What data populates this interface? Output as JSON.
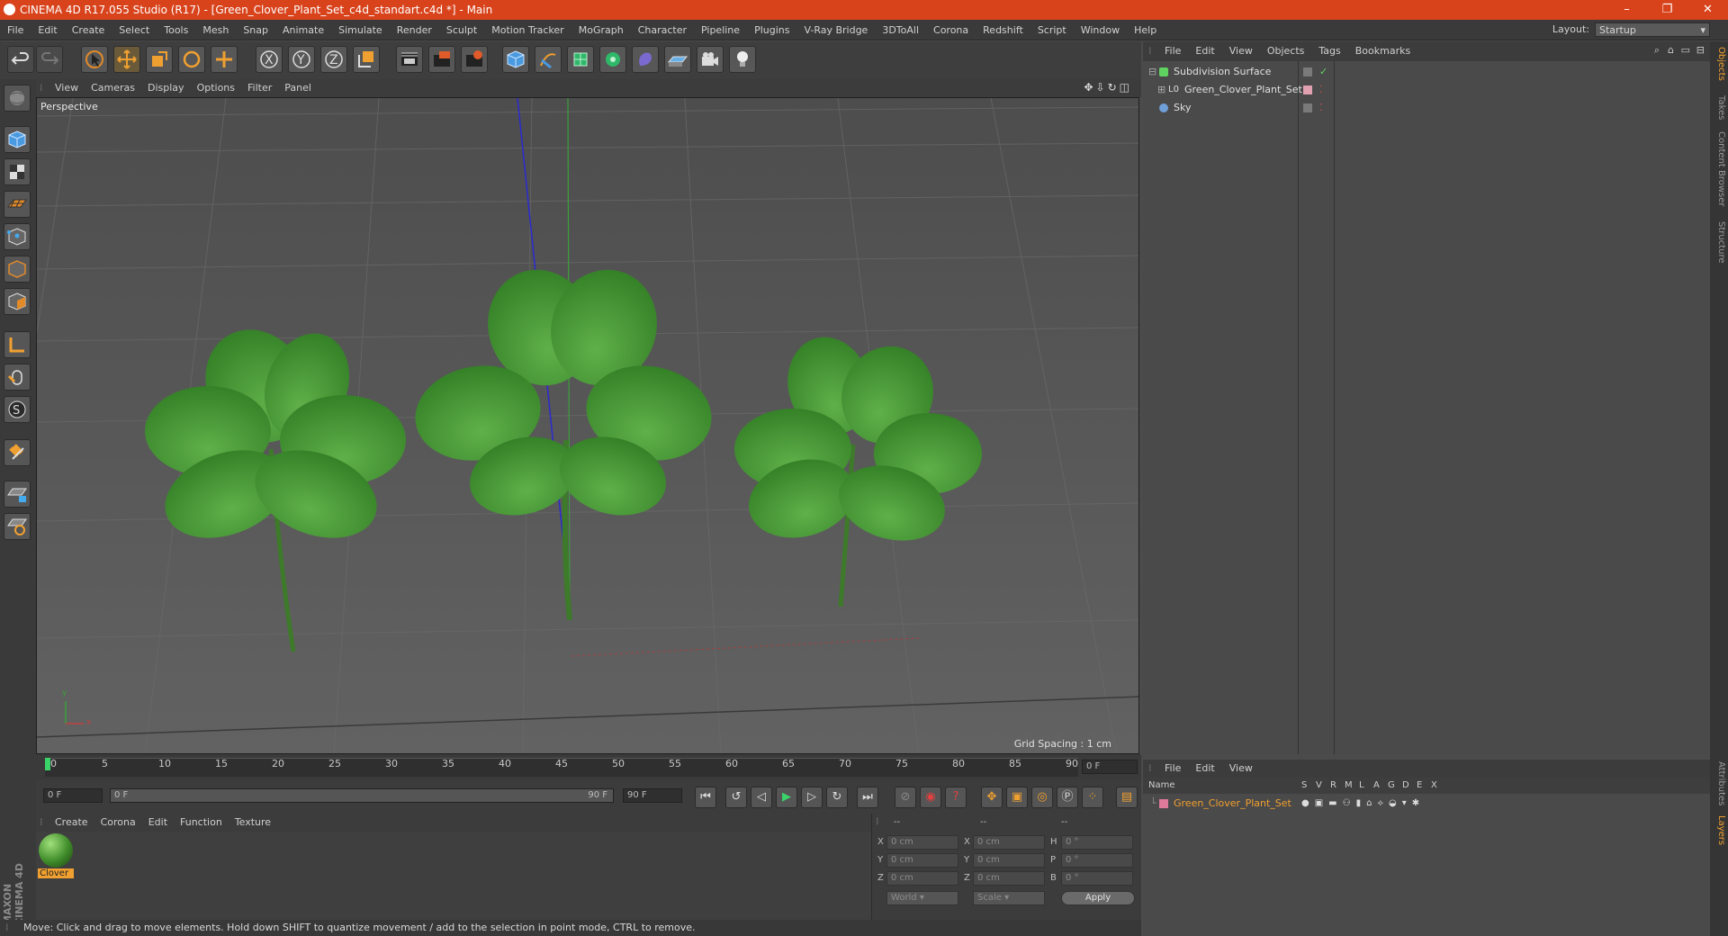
{
  "window": {
    "title": "CINEMA 4D R17.055 Studio (R17) - [Green_Clover_Plant_Set_c4d_standart.c4d *] - Main",
    "minimize": "–",
    "maximize": "❐",
    "close": "✕"
  },
  "menu": [
    "File",
    "Edit",
    "Create",
    "Select",
    "Tools",
    "Mesh",
    "Snap",
    "Animate",
    "Simulate",
    "Render",
    "Sculpt",
    "Motion Tracker",
    "MoGraph",
    "Character",
    "Pipeline",
    "Plugins",
    "V-Ray Bridge",
    "3DToAll",
    "Corona",
    "Redshift",
    "Script",
    "Window",
    "Help"
  ],
  "layout": {
    "label": "Layout:",
    "value": "Startup"
  },
  "toolbar": {
    "icons": [
      "undo-icon",
      "redo-icon",
      "select-arrow-icon",
      "move-icon",
      "scale-icon",
      "rotate-icon",
      "live-select-icon",
      "x-axis-icon",
      "y-axis-icon",
      "z-axis-icon",
      "world-coord-icon",
      "render-view-icon",
      "render-picture-viewer-icon",
      "render-settings-icon",
      "cube-icon",
      "pen-spline-icon",
      "subdivision-icon",
      "mograph-cloner-icon",
      "deformer-icon",
      "floor-icon",
      "camera-icon",
      "light-icon"
    ]
  },
  "viewport": {
    "menu": [
      "View",
      "Cameras",
      "Display",
      "Options",
      "Filter",
      "Panel"
    ],
    "label": "Perspective",
    "grid_spacing": "Grid Spacing : 1 cm",
    "axis_y": "y",
    "axis_x": "x"
  },
  "timeline": {
    "ticks": [
      "0",
      "5",
      "10",
      "15",
      "20",
      "25",
      "30",
      "35",
      "40",
      "45",
      "50",
      "55",
      "60",
      "65",
      "70",
      "75",
      "80",
      "85",
      "90"
    ],
    "end_field": "0 F",
    "start_frame": "0 F",
    "range_start": "0 F",
    "range_end": "90 F",
    "max_frame": "90 F"
  },
  "material": {
    "menu": [
      "Create",
      "Corona",
      "Edit",
      "Function",
      "Texture"
    ],
    "name": "Clover",
    "color": "#3f8b2a"
  },
  "coords": {
    "headers": [
      "--",
      "--",
      "--"
    ],
    "rows": [
      {
        "a": "X",
        "av": "0 cm",
        "b": "X",
        "bv": "0 cm",
        "c": "H",
        "cv": "0 °"
      },
      {
        "a": "Y",
        "av": "0 cm",
        "b": "Y",
        "bv": "0 cm",
        "c": "P",
        "cv": "0 °"
      },
      {
        "a": "Z",
        "av": "0 cm",
        "b": "Z",
        "bv": "0 cm",
        "c": "B",
        "cv": "0 °"
      }
    ],
    "world": "World",
    "scale": "Scale",
    "apply": "Apply"
  },
  "status": "Move: Click and drag to move elements. Hold down SHIFT to quantize movement / add to the selection in point mode, CTRL to remove.",
  "objects": {
    "menu": [
      "File",
      "Edit",
      "View",
      "Objects",
      "Tags",
      "Bookmarks"
    ],
    "items": [
      {
        "name": "Subdivision Surface",
        "color": "#5fd35f"
      },
      {
        "name": "Green_Clover_Plant_Set",
        "color": "#8c8c8c"
      },
      {
        "name": "Sky",
        "color": "#6f9fd8"
      }
    ]
  },
  "layers": {
    "menu": [
      "File",
      "Edit",
      "View"
    ],
    "name_header": "Name",
    "columns": [
      "S",
      "V",
      "R",
      "M",
      "L",
      "A",
      "G",
      "D",
      "E",
      "X"
    ],
    "items": [
      {
        "name": "Green_Clover_Plant_Set",
        "color": "#e07a9a"
      }
    ]
  },
  "right_tabs": [
    "Objects",
    "Takes",
    "Content Browser",
    "Structure",
    "Attributes",
    "Layers"
  ],
  "brand": "MAXON CINEMA 4D"
}
